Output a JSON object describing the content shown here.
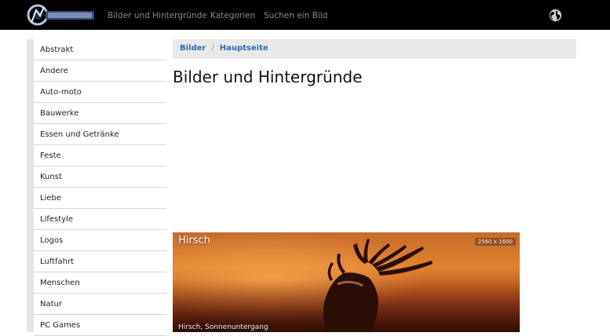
{
  "header": {
    "logo_name": "site-logo",
    "nav": [
      {
        "label": "Bilder und Hintergründe"
      },
      {
        "label": "Kategorien"
      },
      {
        "label": "Suchen ein Bild"
      }
    ],
    "language_icon": "globe-icon"
  },
  "sidebar": {
    "items": [
      {
        "label": "Abstrakt"
      },
      {
        "label": "Andere"
      },
      {
        "label": "Auto-moto"
      },
      {
        "label": "Bauwerke"
      },
      {
        "label": "Essen und Getränke"
      },
      {
        "label": "Feste"
      },
      {
        "label": "Kunst"
      },
      {
        "label": "Liebe"
      },
      {
        "label": "Lifestyle"
      },
      {
        "label": "Logos"
      },
      {
        "label": "Luftfahrt"
      },
      {
        "label": "Menschen"
      },
      {
        "label": "Natur"
      },
      {
        "label": "PC Games"
      }
    ]
  },
  "breadcrumb": {
    "items": [
      {
        "label": "Bilder"
      },
      {
        "label": "Hauptseite"
      }
    ],
    "separator": "/"
  },
  "main": {
    "title": "Bilder und Hintergründe",
    "featured": {
      "title": "Hirsch",
      "resolution": "2560 x 1600",
      "caption": "Hirsch, Sonnenuntergang"
    }
  },
  "colors": {
    "topbar": "#000000",
    "link": "#2a6ab3",
    "nav_text": "#8c8c8c"
  }
}
